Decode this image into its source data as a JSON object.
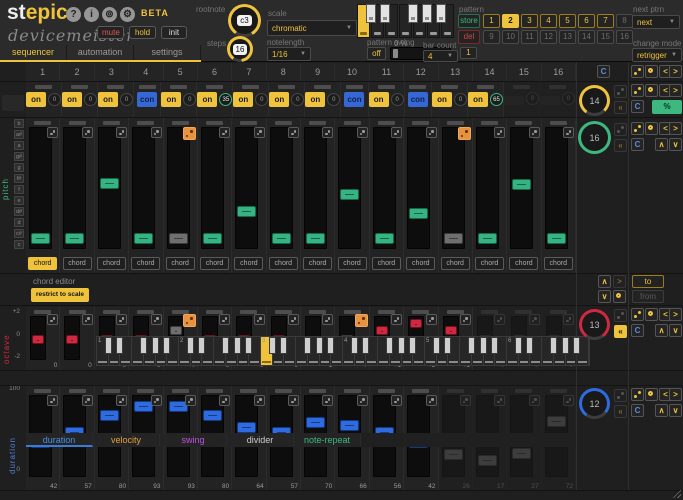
{
  "header": {
    "logo": {
      "part1": "st",
      "part2": "epic"
    },
    "brand": "devicemeister",
    "beta": "BETA",
    "icons": [
      "help-icon",
      "info-icon",
      "midi-icon",
      "gear-icon"
    ],
    "icon_glyphs": [
      "?",
      "i",
      "⊚",
      "⚙"
    ],
    "mute_label": "mute",
    "hold_label": "hold",
    "init_label": "init",
    "tabs": [
      {
        "label": "sequencer",
        "active": true
      },
      {
        "label": "automation",
        "active": false
      },
      {
        "label": "settings",
        "active": false
      }
    ],
    "rootnote": {
      "label": "rootnote",
      "value": "c3"
    },
    "steps_knob": {
      "label": "steps",
      "value": "16"
    },
    "scale": {
      "label": "scale",
      "value": "chromatic"
    },
    "notelength": {
      "label": "notelength",
      "value": "1/16"
    },
    "pattern_swing": {
      "label": "pattern swing",
      "off_label": "off",
      "value": "0 %"
    },
    "bar_count": {
      "label": "bar count",
      "value": "4",
      "current_bar": "1"
    },
    "scale_keyboard": {
      "root_key": "c",
      "root_index": 0
    },
    "pattern": {
      "label": "pattern",
      "store_label": "store",
      "del_label": "del",
      "buttons": [
        "1",
        "2",
        "3",
        "4",
        "5",
        "6",
        "7",
        "8",
        "9",
        "10",
        "11",
        "12",
        "13",
        "14",
        "15",
        "16"
      ],
      "filled": [
        1,
        2,
        3,
        4,
        5,
        6,
        7
      ],
      "active": 2
    },
    "next_ptrn": {
      "label": "next ptrn",
      "value": "next"
    },
    "change_mode": {
      "label": "change mode",
      "value": "retrigger"
    }
  },
  "sequencer": {
    "step_numbers": [
      "1",
      "2",
      "3",
      "4",
      "5",
      "6",
      "7",
      "8",
      "9",
      "10",
      "11",
      "12",
      "13",
      "14",
      "15",
      "16"
    ],
    "on_lane": {
      "length": 14,
      "steps": [
        {
          "state": "on",
          "knob": "0"
        },
        {
          "state": "on",
          "knob": "0"
        },
        {
          "state": "on",
          "knob": "0"
        },
        {
          "state": "con",
          "knob": null
        },
        {
          "state": "on",
          "knob": "0"
        },
        {
          "state": "on",
          "knob": "35",
          "knob_active": true
        },
        {
          "state": "on",
          "knob": "0"
        },
        {
          "state": "on",
          "knob": "0"
        },
        {
          "state": "on",
          "knob": "0"
        },
        {
          "state": "con",
          "knob": null
        },
        {
          "state": "on",
          "knob": "0"
        },
        {
          "state": "con",
          "knob": null
        },
        {
          "state": "on",
          "knob": "0"
        },
        {
          "state": "on",
          "knob": "65",
          "knob_active": true
        },
        {
          "state": "off",
          "knob": "0"
        },
        {
          "state": "off",
          "knob": "0"
        }
      ],
      "panel": {
        "knob": "14",
        "color": "#f0c33c",
        "percent_label": "%"
      }
    },
    "pitch_lane": {
      "label": "pitch",
      "color": "#3db87f",
      "length": 16,
      "note_buttons": [
        "b",
        "a#",
        "a",
        "g#",
        "g",
        "f#",
        "f",
        "e",
        "d#",
        "d",
        "c#",
        "c"
      ],
      "chord_label": "chord",
      "chord_active_step": 1,
      "positions_pct": [
        95,
        95,
        45,
        95,
        95,
        95,
        70,
        95,
        95,
        55,
        95,
        72,
        95,
        95,
        46,
        95
      ],
      "random_steps": [
        5,
        13
      ],
      "panel": {
        "knob": "16"
      }
    },
    "chord_editor": {
      "label": "chord editor",
      "restrict_label": "restrict to scale",
      "octave_labels": [
        "1",
        "2",
        "3",
        "4",
        "5",
        "6"
      ],
      "selected_key": "c3",
      "to_label": "to",
      "from_label": "from"
    },
    "octave_lane": {
      "label": "octave",
      "color": "#d02840",
      "length": 13,
      "axis": [
        "+2",
        "0",
        "-2"
      ],
      "values": [
        "0",
        "0",
        "0",
        "0",
        "+1",
        "0",
        "0",
        "0",
        "-1",
        "0",
        "+1",
        "+2",
        "+1",
        "0",
        "0",
        "0"
      ],
      "random_steps": [
        5,
        10
      ],
      "panel": {
        "knob": "13"
      }
    },
    "bottom_tabs": [
      {
        "label": "duration",
        "color": "#4a90e2",
        "active": true
      },
      {
        "label": "velocity",
        "color": "#e0a03c",
        "active": false
      },
      {
        "label": "swing",
        "color": "#c050e0",
        "active": false
      },
      {
        "label": "divider",
        "color": "#cccccc",
        "active": false
      },
      {
        "label": "note-repeat",
        "color": "#3db87f",
        "active": false
      }
    ],
    "duration_lane": {
      "label": "duration",
      "color": "#2e6be0",
      "length": 12,
      "axis_top": "100",
      "axis_bottom": "0",
      "values": [
        42,
        57,
        80,
        93,
        93,
        80,
        64,
        57,
        70,
        66,
        56,
        42,
        26,
        17,
        27,
        72
      ],
      "panel": {
        "knob": "12"
      }
    }
  }
}
